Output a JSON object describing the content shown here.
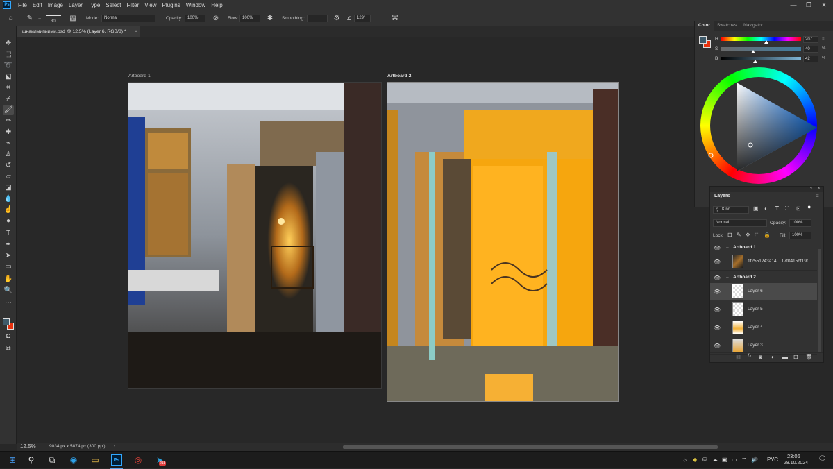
{
  "menubar": {
    "logo": "Ps",
    "items": [
      "File",
      "Edit",
      "Image",
      "Layer",
      "Type",
      "Select",
      "Filter",
      "View",
      "Plugins",
      "Window",
      "Help"
    ]
  },
  "options": {
    "brush_size": "30",
    "mode_label": "Mode:",
    "mode_value": "Normal",
    "opacity_label": "Opacity:",
    "opacity_value": "100%",
    "flow_label": "Flow:",
    "flow_value": "100%",
    "smoothing_label": "Smoothing:",
    "angle_value": "129°"
  },
  "document": {
    "tab_title": "шнаилмипиими.psd @ 12,5% (Layer 6, RGB/8) *",
    "tab_close": "×"
  },
  "artboards": [
    {
      "label": "Artboard 1"
    },
    {
      "label": "Artboard 2"
    }
  ],
  "status": {
    "zoom": "12.5%",
    "doc_info": "9034 px x 5874 px (300 ppi)"
  },
  "color_panel": {
    "tabs": [
      "Color",
      "Swatches",
      "Navigator"
    ],
    "h_label": "H",
    "h_value": "207",
    "s_label": "S",
    "s_value": "40",
    "s_unit": "%",
    "b_label": "B",
    "b_value": "42",
    "b_unit": "%",
    "foreground": "#3e5a6a",
    "background": "#e8320e"
  },
  "layers_panel": {
    "title": "Layers",
    "kind_label": "Kind",
    "blend_mode": "Normal",
    "opacity_label": "Opacity:",
    "opacity_value": "100%",
    "lock_label": "Lock:",
    "fill_label": "Fill:",
    "fill_value": "100%",
    "groups": [
      {
        "name": "Artboard 1"
      },
      {
        "name": "Artboard 2"
      }
    ],
    "layers": [
      {
        "name": "1f2551243a14....17f0415bf19f"
      },
      {
        "name": "Layer 6"
      },
      {
        "name": "Layer 5"
      },
      {
        "name": "Layer 4"
      },
      {
        "name": "Layer 3"
      }
    ]
  },
  "taskbar": {
    "language": "РУС",
    "time": "23:06",
    "date": "28.10.2024",
    "telegram_badge": "218"
  }
}
